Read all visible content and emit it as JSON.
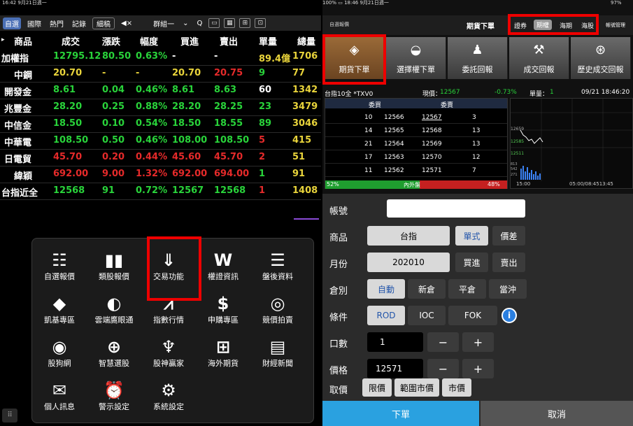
{
  "left_status": {
    "time": "16:42  9月21日週一"
  },
  "right_status": {
    "time": "100% ▭ 18:46  9月21日週一",
    "battery": "97%"
  },
  "left_toolbar": {
    "tabs": [
      "自選",
      "國際",
      "熱門",
      "記錄",
      "細稿"
    ],
    "group": "群組一",
    "search": "Q"
  },
  "quote": {
    "headers": [
      "商品",
      "成交",
      "漲跌",
      "幅度",
      "買進",
      "賣出",
      "單量",
      "總量"
    ],
    "rows": [
      [
        "加權指",
        "12795.12",
        "80.50",
        "0.63%",
        "-",
        "-",
        "89.4億",
        "1706"
      ],
      [
        "中鋼",
        "20.70",
        "-",
        "-",
        "20.70",
        "20.75",
        "9",
        "77"
      ],
      [
        "開發金",
        "8.61",
        "0.04",
        "0.46%",
        "8.61",
        "8.63",
        "60",
        "1342"
      ],
      [
        "兆豐金",
        "28.20",
        "0.25",
        "0.88%",
        "28.20",
        "28.25",
        "23",
        "3479"
      ],
      [
        "中信金",
        "18.50",
        "0.10",
        "0.54%",
        "18.50",
        "18.55",
        "89",
        "3046"
      ],
      [
        "中華電",
        "108.50",
        "0.50",
        "0.46%",
        "108.00",
        "108.50",
        "5",
        "415"
      ],
      [
        "日電貿",
        "45.70",
        "0.20",
        "0.44%",
        "45.60",
        "45.70",
        "2",
        "51"
      ],
      [
        "緯穎",
        "692.00",
        "9.00",
        "1.32%",
        "692.00",
        "694.00",
        "1",
        "91"
      ],
      [
        "台指近全",
        "12568",
        "91",
        "0.72%",
        "12567",
        "12568",
        "1",
        "1408"
      ]
    ]
  },
  "menu": {
    "items": [
      {
        "label": "自選報價",
        "icon": "☷"
      },
      {
        "label": "類股報價",
        "icon": "▮▮"
      },
      {
        "label": "交易功能",
        "icon": "⇓"
      },
      {
        "label": "權證資訊",
        "icon": "W"
      },
      {
        "label": "盤後資料",
        "icon": "☰"
      },
      {
        "label": "凱基專區",
        "icon": "◆"
      },
      {
        "label": "雲端鷹眼通",
        "icon": "◐"
      },
      {
        "label": "指數行情",
        "icon": "⩘"
      },
      {
        "label": "申購專區",
        "icon": "$"
      },
      {
        "label": "競價拍賣",
        "icon": "◎"
      },
      {
        "label": "股狗網",
        "icon": "◉"
      },
      {
        "label": "智慧選股",
        "icon": "⊕"
      },
      {
        "label": "股神贏家",
        "icon": "♆"
      },
      {
        "label": "海外期貨",
        "icon": "⊞"
      },
      {
        "label": "財經新聞",
        "icon": "▤"
      },
      {
        "label": "個人訊息",
        "icon": "✉"
      },
      {
        "label": "警示設定",
        "icon": "⏰"
      },
      {
        "label": "系統設定",
        "icon": "⚙"
      }
    ]
  },
  "right_top": {
    "left_label": "自選報價",
    "center_title": "期貨下單",
    "tabs": [
      "證券",
      "期權",
      "海期",
      "海股"
    ],
    "account_mgmt": "帳號管理"
  },
  "big_buttons": [
    {
      "label": "期貨下單",
      "icon": "◈"
    },
    {
      "label": "選擇權下單",
      "icon": "◒"
    },
    {
      "label": "委託回報",
      "icon": "♟"
    },
    {
      "label": "成交回報",
      "icon": "⚒"
    },
    {
      "label": "歷史成交回報",
      "icon": "⊛"
    }
  ],
  "ticker": {
    "name": "台指10全 *TXV0",
    "price_label": "現價：",
    "price": "12567",
    "change": "-0.73%",
    "unit_label": "單量：",
    "unit": "1",
    "datetime": "09/21 18:46:20"
  },
  "orderbook": {
    "buy_header": "委買",
    "sell_header": "委賣",
    "rows": [
      [
        "10",
        "12566",
        "12567",
        "3"
      ],
      [
        "14",
        "12565",
        "12568",
        "13"
      ],
      [
        "21",
        "12564",
        "12569",
        "13"
      ],
      [
        "17",
        "12563",
        "12570",
        "12"
      ],
      [
        "11",
        "12562",
        "12571",
        "7"
      ]
    ],
    "inner_pct": "52%",
    "outer_pct": "48%",
    "label": "內外盤"
  },
  "minichart": {
    "labels": [
      "12659",
      "12585",
      "12511"
    ],
    "vol_labels": [
      "813",
      "542",
      "271"
    ],
    "x_left": "15:00",
    "x_right": "05:00/08:4513:45"
  },
  "form": {
    "account_label": "帳號",
    "product_label": "商品",
    "product_value": "台指",
    "type_single": "單式",
    "type_spread": "價差",
    "month_label": "月份",
    "month_value": "202010",
    "buy": "買進",
    "sell": "賣出",
    "position_label": "倉別",
    "positions": [
      "自動",
      "新倉",
      "平倉",
      "當沖"
    ],
    "condition_label": "條件",
    "conditions": [
      "ROD",
      "IOC",
      "FOK"
    ],
    "info": "i",
    "qty_label": "口數",
    "qty_value": "1",
    "price_label": "價格",
    "price_value": "12571",
    "minus": "−",
    "plus": "+",
    "price_type_label": "取價",
    "price_types": [
      "限價",
      "範圍市價",
      "市價"
    ],
    "submit": "下單",
    "cancel": "取消"
  }
}
